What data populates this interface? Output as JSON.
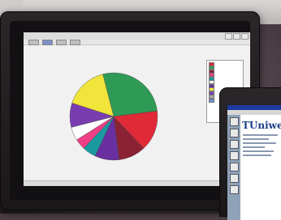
{
  "second_window": {
    "heading": "TUniweb"
  },
  "chart_data": {
    "type": "pie",
    "slices": [
      {
        "value": 27,
        "color": "#2f9a55"
      },
      {
        "value": 15,
        "color": "#e02a38"
      },
      {
        "value": 10,
        "color": "#8a2234"
      },
      {
        "value": 9,
        "color": "#6a2fa0"
      },
      {
        "value": 5,
        "color": "#1a9aa0"
      },
      {
        "value": 4,
        "color": "#ef3f86"
      },
      {
        "value": 5,
        "color": "#ffffff"
      },
      {
        "value": 9,
        "color": "#7a3db0"
      },
      {
        "value": 16,
        "color": "#f1e43a"
      }
    ]
  },
  "legend_colors": [
    "#e02a38",
    "#2f9a55",
    "#8a2234",
    "#ef3f86",
    "#1a9aa0",
    "#ffffff",
    "#6a2fa0",
    "#f1e43a",
    "#7a3db0",
    "#a8a8a8",
    "#6c8fd6"
  ]
}
